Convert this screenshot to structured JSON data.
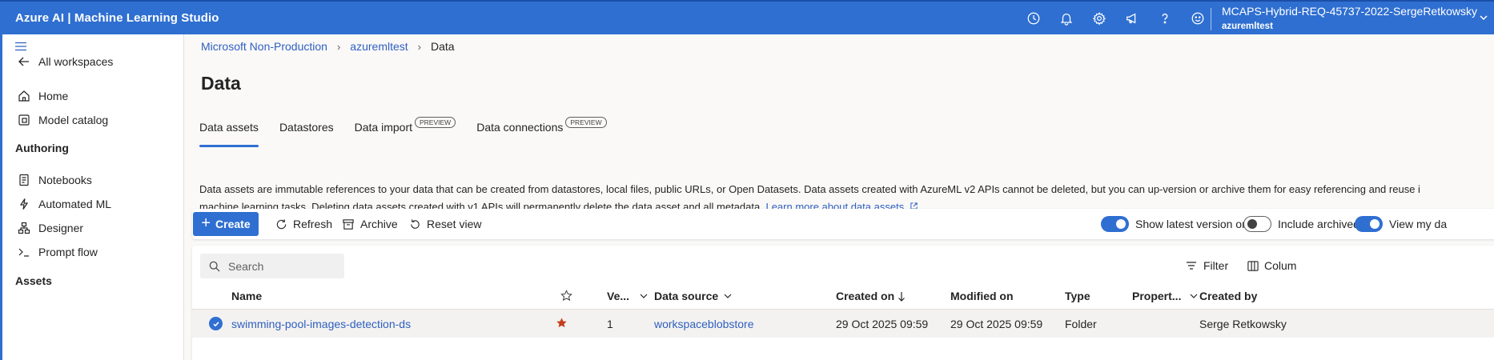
{
  "app": {
    "title": "Azure AI | Machine Learning Studio"
  },
  "header": {
    "icons": [
      "history-icon",
      "bell-icon",
      "gear-icon",
      "megaphone-icon",
      "help-icon",
      "smiley-icon"
    ],
    "subscription": "MCAPS-Hybrid-REQ-45737-2022-SergeRetkowsky",
    "workspace": "azuremltest"
  },
  "sidebar": {
    "all_workspaces": "All workspaces",
    "home": "Home",
    "model_catalog": "Model catalog",
    "authoring": "Authoring",
    "notebooks": "Notebooks",
    "automated_ml": "Automated ML",
    "designer": "Designer",
    "prompt_flow": "Prompt flow",
    "assets": "Assets"
  },
  "breadcrumb": [
    "Microsoft Non-Production",
    "azuremltest",
    "Data"
  ],
  "page": {
    "title": "Data"
  },
  "tabs": [
    {
      "label": "Data assets",
      "badge": ""
    },
    {
      "label": "Datastores",
      "badge": ""
    },
    {
      "label": "Data import",
      "badge": "PREVIEW"
    },
    {
      "label": "Data connections",
      "badge": "PREVIEW"
    }
  ],
  "description": {
    "line1": "Data assets are immutable references to your data that can be created from datastores, local files, public URLs, or Open Datasets. Data assets created with AzureML v2 APIs cannot be deleted, but you can up-version or archive them for easy referencing and reuse i",
    "line2": "machine learning tasks. Deleting data assets created with v1 APIs will permanently delete the data asset and all metadata.",
    "link": "Learn more about data assets"
  },
  "toolbar": {
    "create": "Create",
    "refresh": "Refresh",
    "archive": "Archive",
    "reset_view": "Reset view",
    "show_latest": "Show latest version only",
    "show_latest_on": true,
    "include_archived": "Include archived",
    "include_archived_on": false,
    "view_my": "View my da"
  },
  "grid": {
    "search_placeholder": "Search",
    "filter": "Filter",
    "columns": "Colum",
    "headers": {
      "name": "Name",
      "version": "Ve...",
      "data_source": "Data source",
      "created_on": "Created on",
      "modified_on": "Modified on",
      "type": "Type",
      "properties": "Propert...",
      "created_by": "Created by"
    },
    "rows": [
      {
        "name": "swimming-pool-images-detection-ds",
        "favorite": true,
        "version": "1",
        "data_source": "workspaceblobstore",
        "created_on": "29 Oct 2025 09:59",
        "modified_on": "29 Oct 2025 09:59",
        "type": "Folder",
        "properties": "",
        "created_by": "Serge Retkowsky"
      }
    ]
  },
  "colors": {
    "accent": "#2f6fd1",
    "link": "#2f5fbf",
    "star": "#c43e1c"
  }
}
